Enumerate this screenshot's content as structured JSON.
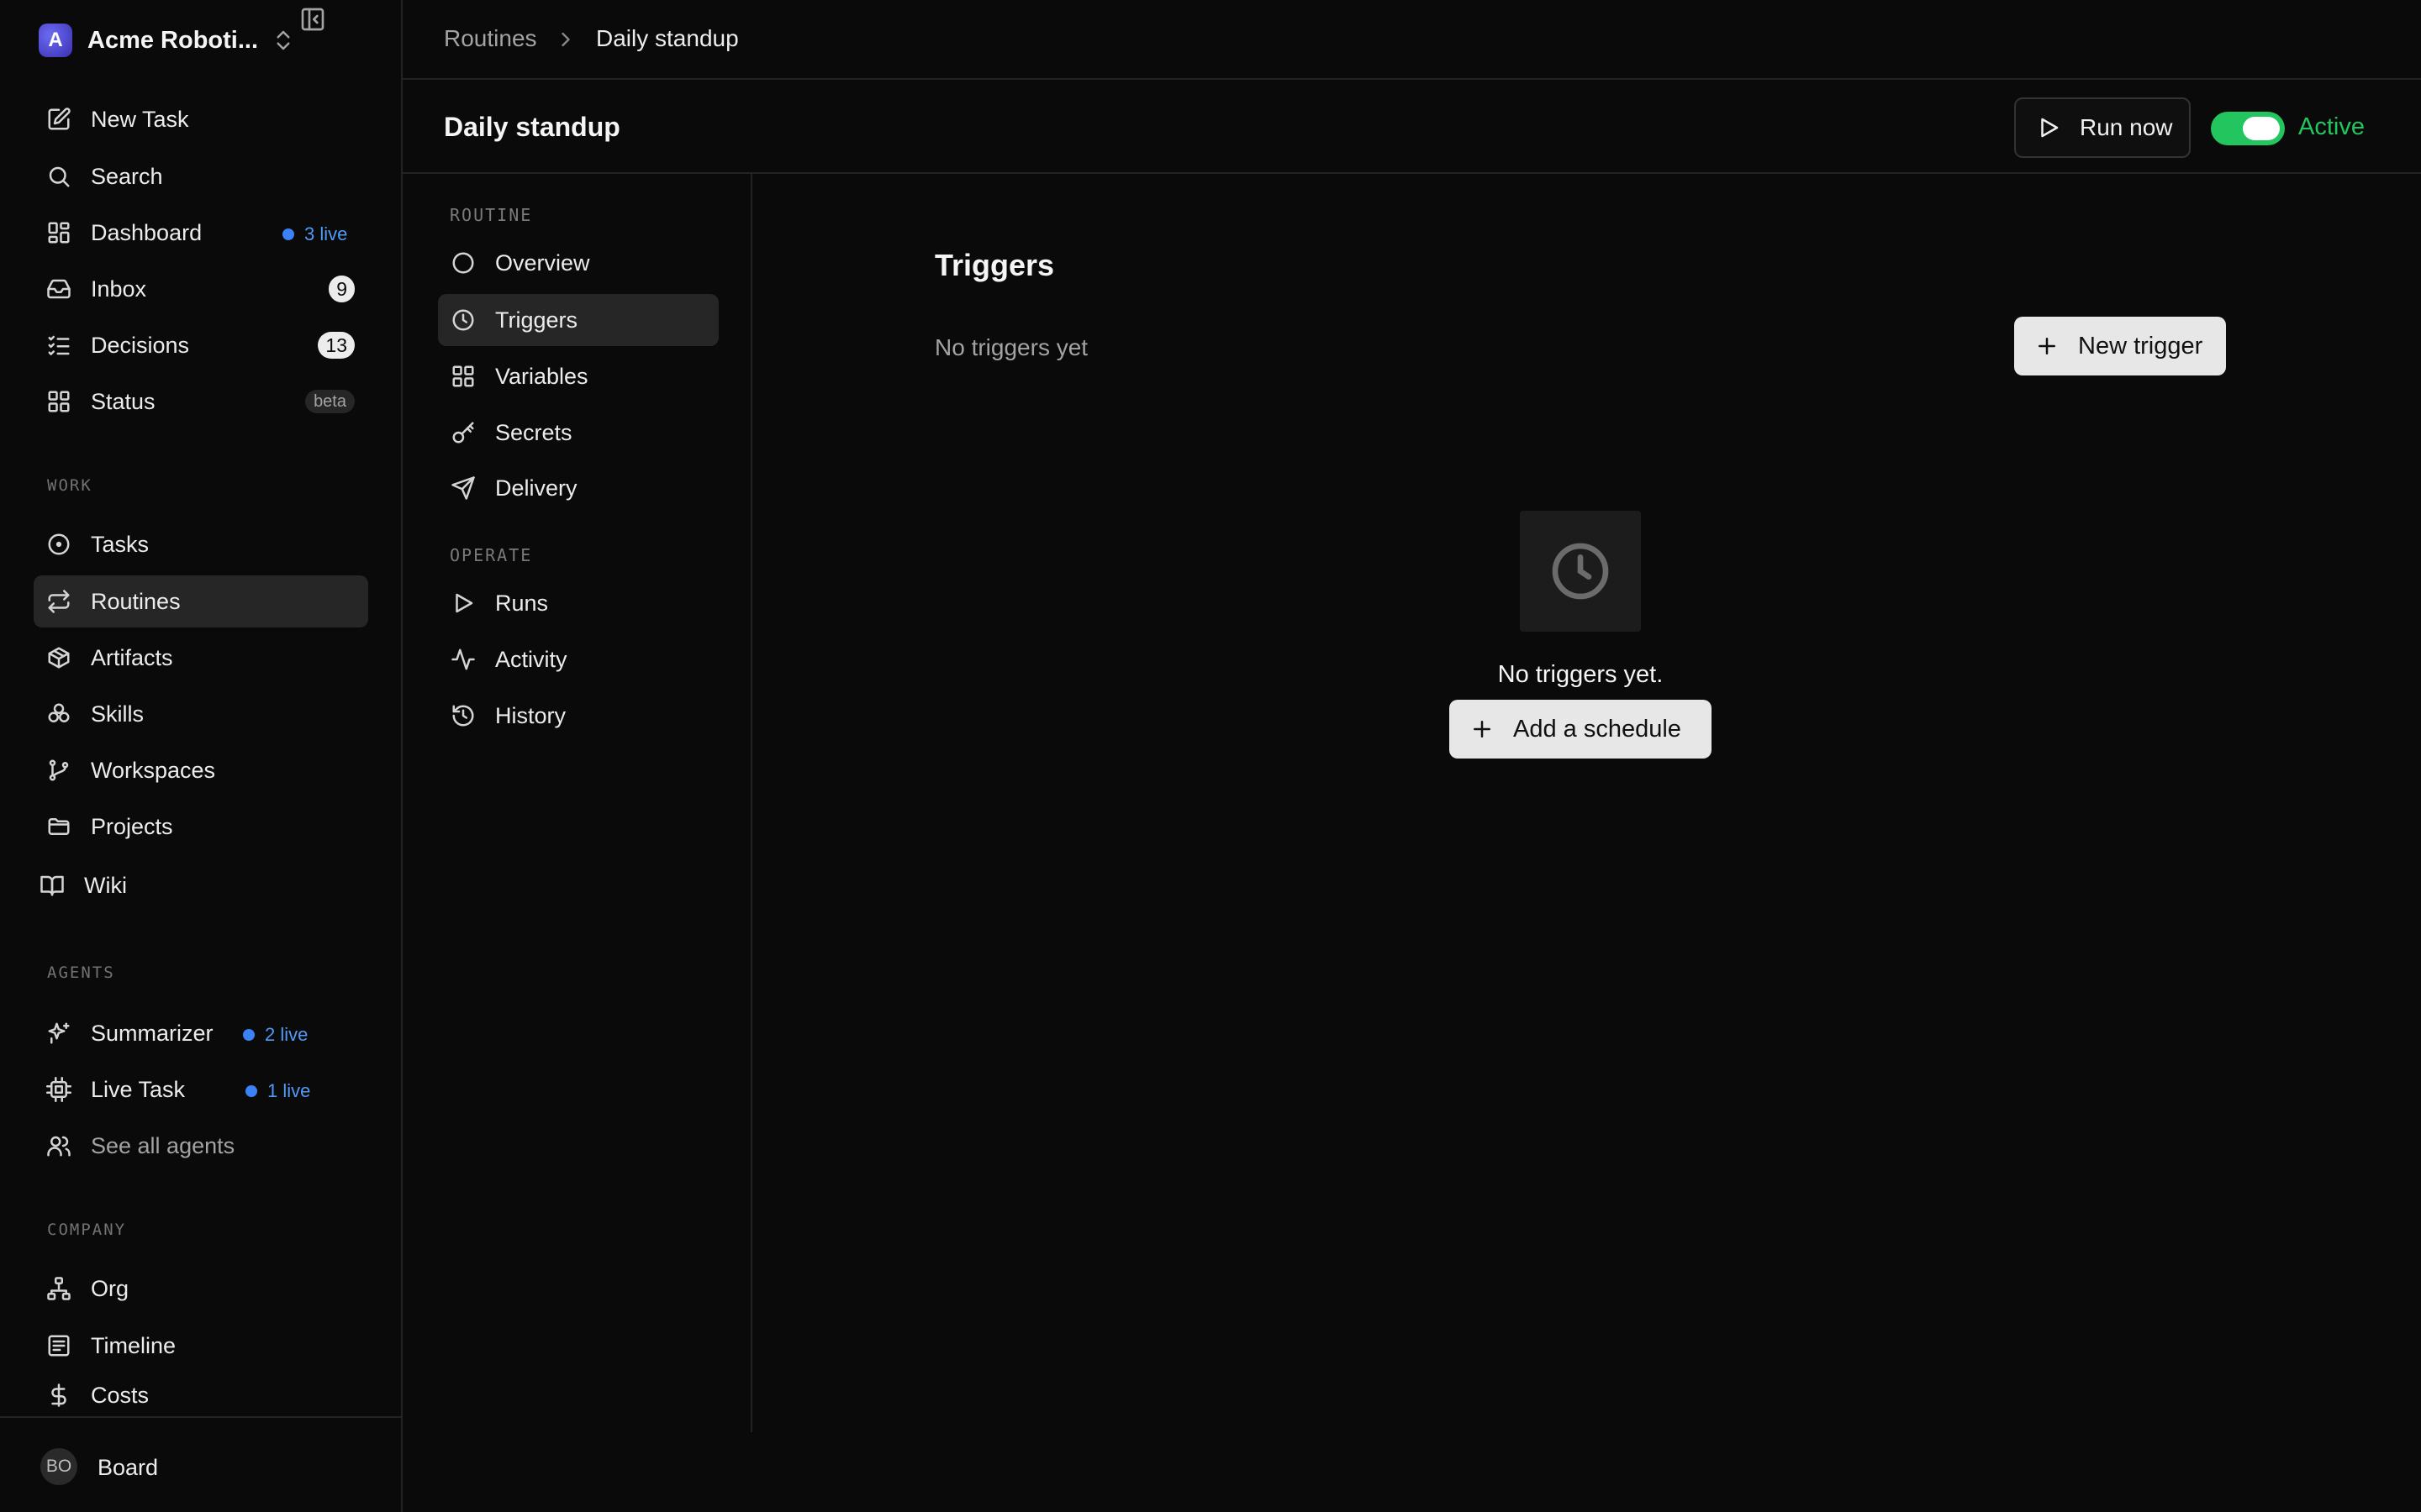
{
  "workspace": {
    "avatar_letter": "A",
    "name": "Acme Roboti..."
  },
  "sidebar": {
    "primary": [
      {
        "label": "New Task",
        "icon": "edit-icon"
      },
      {
        "label": "Search",
        "icon": "search-icon"
      },
      {
        "label": "Dashboard",
        "icon": "grid-icon",
        "live": "3 live"
      },
      {
        "label": "Inbox",
        "icon": "inbox-icon",
        "count": "9"
      },
      {
        "label": "Decisions",
        "icon": "checklist-icon",
        "count": "13"
      },
      {
        "label": "Status",
        "icon": "grid-icon",
        "badge": "beta"
      }
    ],
    "work_label": "WORK",
    "work": [
      {
        "label": "Tasks",
        "icon": "circle-dot-icon"
      },
      {
        "label": "Routines",
        "icon": "repeat-icon",
        "active": true
      },
      {
        "label": "Artifacts",
        "icon": "package-icon"
      },
      {
        "label": "Skills",
        "icon": "boxes-icon"
      },
      {
        "label": "Workspaces",
        "icon": "git-branch-icon"
      },
      {
        "label": "Projects",
        "icon": "folder-icon"
      },
      {
        "label": "Wiki",
        "icon": "book-icon"
      }
    ],
    "agents_label": "AGENTS",
    "agents": [
      {
        "label": "Summarizer",
        "icon": "sparkles-icon",
        "live": "2 live"
      },
      {
        "label": "Live Task",
        "icon": "cpu-icon",
        "live": "1 live"
      },
      {
        "label": "See all agents",
        "icon": "users-icon"
      }
    ],
    "company_label": "COMPANY",
    "company": [
      {
        "label": "Org",
        "icon": "org-chart-icon"
      },
      {
        "label": "Timeline",
        "icon": "timeline-icon"
      },
      {
        "label": "Costs",
        "icon": "dollar-icon"
      }
    ],
    "user": {
      "initials": "BO",
      "name": "Board"
    }
  },
  "breadcrumb": {
    "parent": "Routines",
    "current": "Daily standup"
  },
  "header": {
    "title": "Daily standup",
    "run_label": "Run now",
    "status_label": "Active",
    "active": true,
    "accent_color": "#22c55e"
  },
  "subnav": {
    "routine_label": "ROUTINE",
    "routine": [
      {
        "label": "Overview",
        "icon": "circle-icon"
      },
      {
        "label": "Triggers",
        "icon": "clock-icon",
        "active": true
      },
      {
        "label": "Variables",
        "icon": "grid-icon"
      },
      {
        "label": "Secrets",
        "icon": "key-icon"
      },
      {
        "label": "Delivery",
        "icon": "send-icon"
      }
    ],
    "operate_label": "OPERATE",
    "operate": [
      {
        "label": "Runs",
        "icon": "play-icon"
      },
      {
        "label": "Activity",
        "icon": "activity-icon"
      },
      {
        "label": "History",
        "icon": "history-icon"
      }
    ]
  },
  "triggers": {
    "title": "Triggers",
    "summary": "No triggers yet",
    "new_button": "New trigger",
    "empty_message": "No triggers yet.",
    "empty_icon": "clock-icon",
    "add_button": "Add a schedule"
  }
}
